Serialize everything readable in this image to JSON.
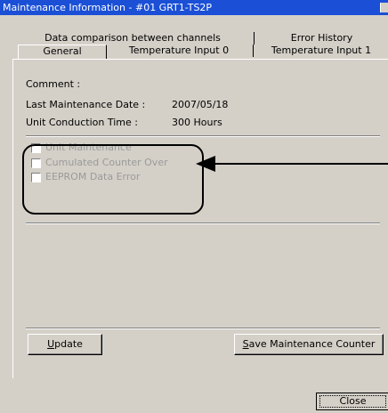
{
  "window": {
    "title": "Maintenance Information - #01 GRT1-TS2P"
  },
  "tabs_back": [
    {
      "label": "Data comparison between channels"
    },
    {
      "label": "Error History"
    }
  ],
  "tabs_front": [
    {
      "label": "General",
      "active": true
    },
    {
      "label": "Temperature Input 0"
    },
    {
      "label": "Temperature Input 1"
    }
  ],
  "general": {
    "comment_label": "Comment :",
    "comment_value": "",
    "last_maintenance_label": "Last Maintenance Date :",
    "last_maintenance_value": "2007/05/18",
    "unit_conduction_label": "Unit Conduction Time :",
    "unit_conduction_value": "300 Hours"
  },
  "checkboxes": [
    {
      "label": "Unit Maintenance",
      "checked": false,
      "enabled": false
    },
    {
      "label": "Cumulated Counter Over",
      "checked": false,
      "enabled": false
    },
    {
      "label": "EEPROM Data Error",
      "checked": false,
      "enabled": false
    }
  ],
  "buttons": {
    "update": "Update",
    "save_counter": "Save Maintenance Counter",
    "close": "Close"
  },
  "annotation": {
    "arrow": "left-arrow",
    "highlight": "rounded-rectangle"
  },
  "colors": {
    "titlebar": "#1a4fd6",
    "window": "#d4d0c8",
    "disabled_text": "#9a9a9a"
  }
}
